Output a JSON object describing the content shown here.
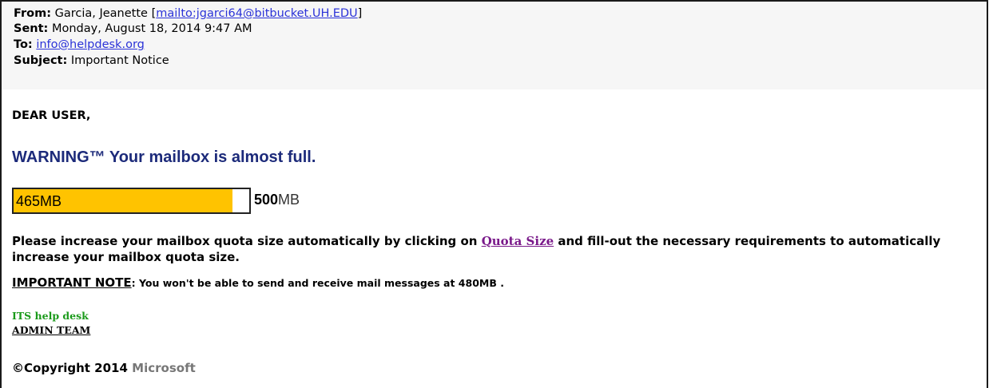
{
  "header": {
    "from_label": "From:",
    "from_name": "Garcia, Jeanette",
    "from_link": "mailto:jgarci64@bitbucket.UH.EDU",
    "sent_label": "Sent:",
    "sent_value": "Monday, August 18, 2014 9:47 AM",
    "to_label": "To:",
    "to_value": "info@helpdesk.org",
    "subject_label": "Subject:",
    "subject_value": "Important Notice"
  },
  "body": {
    "greeting": "DEAR USER,",
    "warning": "WARNING™  Your mailbox is almost full.",
    "quota_bar": {
      "used_label": "465MB",
      "used_fraction": 0.93,
      "max_bold": "500",
      "max_unit": "MB",
      "fill_color": "#ffc300"
    },
    "paragraph_before": "Please increase your mailbox quota size automatically by clicking on ",
    "quota_link": "Quota Size",
    "paragraph_after": " and fill-out the necessary requirements to automatically increase your mailbox quota size.",
    "note_label": "IMPORTANT NOTE",
    "note_text": ": You won't be able to send and receive mail messages at 480MB .",
    "signature_line1": "ITS help desk",
    "signature_line2": "ADMIN TEAM",
    "copyright_bold": "©Copyright 2014",
    "copyright_brand": "Microsoft"
  }
}
